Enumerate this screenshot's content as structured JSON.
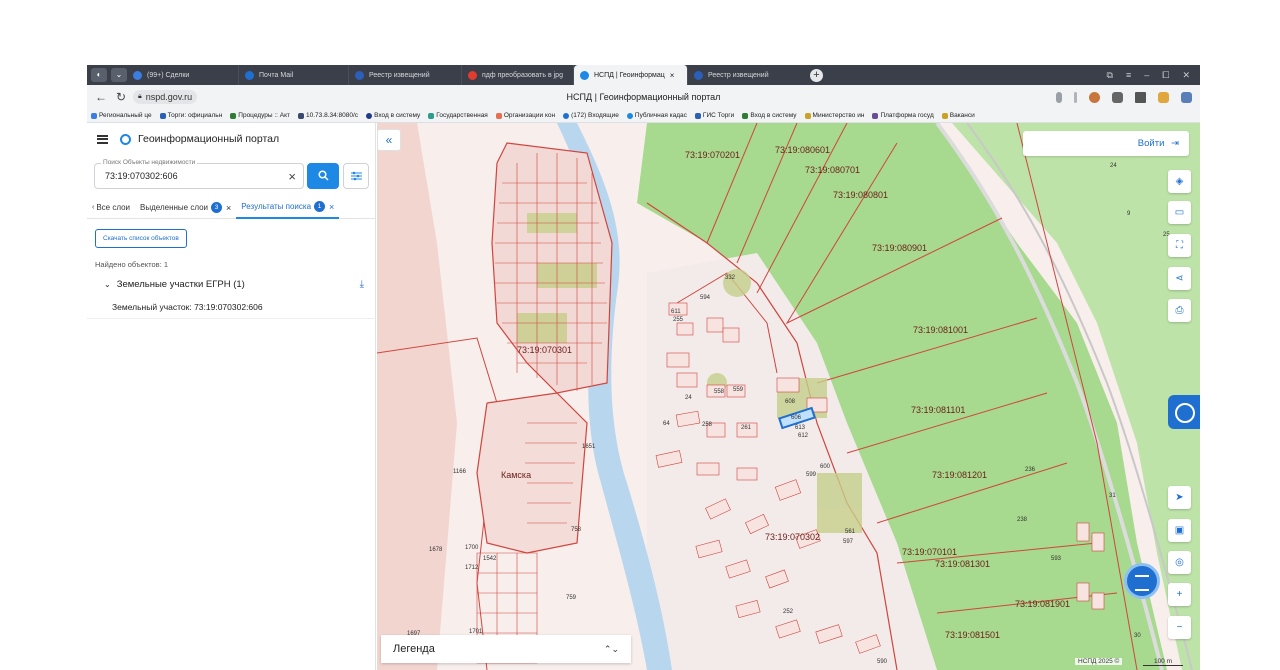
{
  "browser": {
    "tabs": [
      {
        "label": "(99+) Сделки",
        "active": false,
        "fav_color": "#3b7ee0"
      },
      {
        "label": "Почта Mail",
        "active": false,
        "fav_color": "#1e6fd0"
      },
      {
        "label": "Реестр извещений",
        "active": false,
        "fav_color": "#2c5fb8"
      },
      {
        "label": "пдф преобразовать в jpg",
        "active": false,
        "fav_color": "#e23b2f"
      },
      {
        "label": "НСПД | Геоинформац",
        "active": true,
        "fav_color": "#1e88e5"
      },
      {
        "label": "Реестр извещений",
        "active": false,
        "fav_color": "#2c5fb8"
      }
    ],
    "tab_close": "×",
    "new_tab": "+",
    "url": "nspd.gov.ru",
    "page_title": "НСПД | Геоинформационный портал",
    "bookmarks": [
      "Региональный це",
      "Торги: официальн",
      "Процедуры :: Акт",
      "10.73.8.34:8080/c",
      "Вход в систему",
      "Государственная",
      "Организации кон",
      "(172) Входящие",
      "Публичная кадас",
      "ГИС Торги",
      "Вход в систему",
      "Министерство ин",
      "Платформа госуд",
      "Ваканси"
    ]
  },
  "sidebar": {
    "title": "Геоинформационный портал",
    "search": {
      "label": "Поиск Объекты недвижимости",
      "value": "73:19:070302:606",
      "clear": "×"
    },
    "tabs": [
      {
        "label": "Все слои",
        "badge": ""
      },
      {
        "label": "Выделенные слои",
        "badge": "3"
      },
      {
        "label": "Результаты поиска",
        "badge": "1"
      }
    ],
    "download_button": "Скачать список объектов",
    "found_text": "Найдено объектов: 1",
    "group": {
      "label": "Земельные участки ЕГРН (1)"
    },
    "result_item": "Земельный участок: 73:19:070302:606"
  },
  "map": {
    "login": "Войти",
    "legend": "Легенда",
    "attribution": "НСПД 2025 ©",
    "scale": "100 m",
    "labels": [
      {
        "text": "73:19:070201"
      },
      {
        "text": "73:19:080601"
      },
      {
        "text": "73:19:080701"
      },
      {
        "text": "73:19:080801"
      },
      {
        "text": "73:19:080901"
      },
      {
        "text": "73:19:081001"
      },
      {
        "text": "73:19:081101"
      },
      {
        "text": "73:19:081201"
      },
      {
        "text": "73:19:070101"
      },
      {
        "text": "73:19:081301"
      },
      {
        "text": "73:19:081901"
      },
      {
        "text": "73:19:081501"
      },
      {
        "text": "73:19:070302"
      },
      {
        "text": "73:19:070301"
      },
      {
        "text": "Камска"
      }
    ],
    "parcel_numbers": [
      {
        "text": "1651"
      },
      {
        "text": "1166"
      },
      {
        "text": "758"
      },
      {
        "text": "759"
      },
      {
        "text": "611"
      },
      {
        "text": "255"
      },
      {
        "text": "594"
      },
      {
        "text": "332"
      },
      {
        "text": "558"
      },
      {
        "text": "559"
      },
      {
        "text": "608"
      },
      {
        "text": "606"
      },
      {
        "text": "613"
      },
      {
        "text": "612"
      },
      {
        "text": "261"
      },
      {
        "text": "24"
      },
      {
        "text": "64"
      },
      {
        "text": "258"
      },
      {
        "text": "600"
      },
      {
        "text": "599"
      },
      {
        "text": "561"
      },
      {
        "text": "597"
      },
      {
        "text": "252"
      },
      {
        "text": "590"
      },
      {
        "text": "236"
      },
      {
        "text": "238"
      },
      {
        "text": "593"
      },
      {
        "text": "24"
      },
      {
        "text": "9"
      },
      {
        "text": "25"
      },
      {
        "text": "31"
      },
      {
        "text": "30"
      },
      {
        "text": "1678"
      },
      {
        "text": "1700"
      },
      {
        "text": "1712"
      },
      {
        "text": "1542"
      },
      {
        "text": "1701"
      },
      {
        "text": "1697"
      }
    ]
  },
  "colors": {
    "accent": "#1e88e5",
    "parcel_stroke": "#d0453e",
    "forest": "#a7d98e",
    "river": "#b9d6ef"
  }
}
